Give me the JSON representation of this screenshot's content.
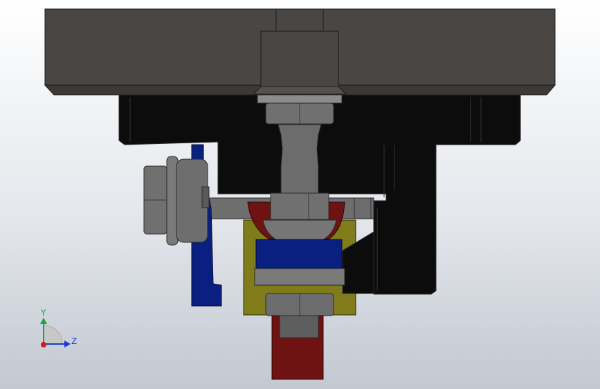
{
  "viewport": {
    "background_top": "#ffffff",
    "background_bottom": "#c3c8d1"
  },
  "colors": {
    "plate": "#4a4644",
    "block": "#0c0c0c",
    "bracket_blue": "#0a2080",
    "housing_yellow": "#807c1c",
    "red_part": "#6e1212",
    "steel": "#6c6c6c",
    "steel_light": "#9a9a9a"
  },
  "triad": {
    "y_label": "Y",
    "z_label": "Z",
    "y_color": "#1aa63a",
    "z_color": "#1a3bd6",
    "origin_color": "#c81e1e"
  }
}
